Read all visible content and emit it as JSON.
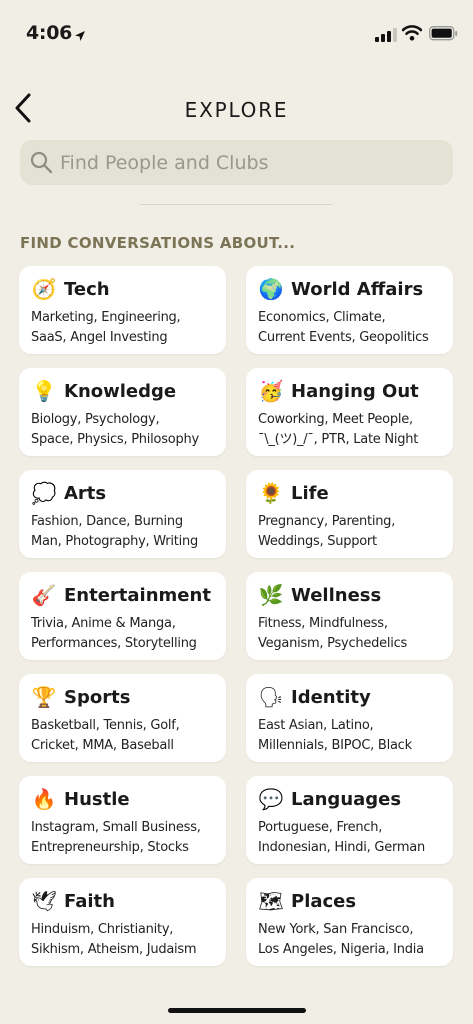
{
  "status_bar": {
    "time": "4:06"
  },
  "nav": {
    "title": "EXPLORE"
  },
  "search": {
    "placeholder": "Find People and Clubs"
  },
  "section_header": "FIND CONVERSATIONS ABOUT...",
  "categories": [
    {
      "emoji": "🧭",
      "icon": "compass-icon",
      "title": "Tech",
      "topics": "Marketing, Engineering,\nSaaS, Angel Investing"
    },
    {
      "emoji": "🌍",
      "icon": "globe-icon",
      "title": "World Affairs",
      "topics": "Economics, Climate,\nCurrent Events, Geopolitics"
    },
    {
      "emoji": "💡",
      "icon": "lightbulb-icon",
      "title": "Knowledge",
      "topics": "Biology, Psychology,\nSpace, Physics, Philosophy"
    },
    {
      "emoji": "🥳",
      "icon": "party-face-icon",
      "title": "Hanging Out",
      "topics": "Coworking, Meet People,\n¯\\_(ツ)_/¯, PTR, Late Night"
    },
    {
      "emoji": "💭",
      "icon": "thought-bubble-icon",
      "title": "Arts",
      "topics": "Fashion, Dance, Burning\nMan, Photography, Writing"
    },
    {
      "emoji": "🌻",
      "icon": "sunflower-icon",
      "title": "Life",
      "topics": "Pregnancy, Parenting,\nWeddings, Support"
    },
    {
      "emoji": "🎸",
      "icon": "guitar-icon",
      "title": "Entertainment",
      "topics": "Trivia, Anime & Manga,\nPerformances, Storytelling"
    },
    {
      "emoji": "🌿",
      "icon": "herb-icon",
      "title": "Wellness",
      "topics": "Fitness, Mindfulness,\nVeganism, Psychedelics"
    },
    {
      "emoji": "🏆",
      "icon": "trophy-icon",
      "title": "Sports",
      "topics": "Basketball, Tennis, Golf,\nCricket, MMA, Baseball"
    },
    {
      "emoji": "🗣",
      "icon": "speaking-head-icon",
      "title": "Identity",
      "topics": "East Asian, Latino,\nMillennials, BIPOC, Black"
    },
    {
      "emoji": "🔥",
      "icon": "fire-icon",
      "title": "Hustle",
      "topics": "Instagram, Small Business,\nEntrepreneurship, Stocks"
    },
    {
      "emoji": "💬",
      "icon": "speech-bubble-icon",
      "title": "Languages",
      "topics": "Portuguese, French,\nIndonesian, Hindi, German"
    },
    {
      "emoji": "🕊",
      "icon": "dove-icon",
      "title": "Faith",
      "topics": "Hinduism, Christianity,\nSikhism, Atheism, Judaism"
    },
    {
      "emoji": "🗺",
      "icon": "map-icon",
      "title": "Places",
      "topics": "New York, San Francisco,\nLos Angeles, Nigeria, India"
    }
  ]
}
